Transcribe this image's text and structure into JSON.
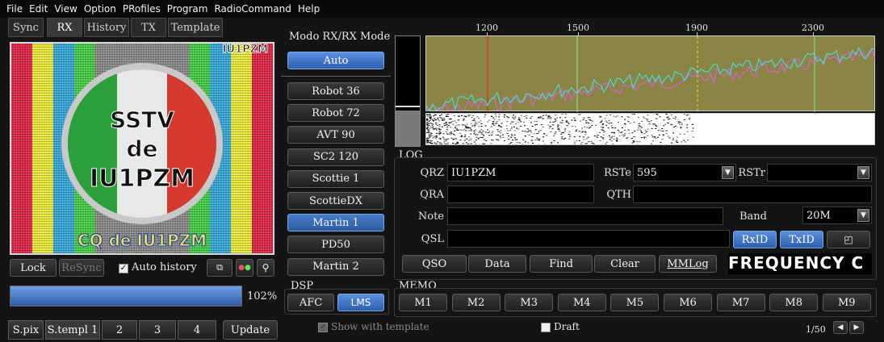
{
  "menu": [
    "File",
    "Edit",
    "View",
    "Option",
    "PRofiles",
    "Program",
    "RadioCommand",
    "Help"
  ],
  "tabs": [
    "Sync",
    "RX",
    "History",
    "TX",
    "Template"
  ],
  "image": {
    "callsign_corner": "IU1PZM",
    "line1": "SSTV",
    "line2": "de",
    "line3": "IU1PZM",
    "bottom": "CQ de IU1PZM"
  },
  "controls": {
    "lock": "Lock",
    "resync": "ReSync",
    "auto_history": "Auto history",
    "progress_pct": "102%",
    "progress_value": 1.0
  },
  "mode": {
    "title": "Modo RX/RX Mode",
    "auto": "Auto",
    "items": [
      "Robot 36",
      "Robot 72",
      "AVT 90",
      "SC2 120",
      "Scottie 1",
      "ScottieDX",
      "Martin 1",
      "PD50",
      "Martin 2"
    ],
    "selected": "Martin 1"
  },
  "spectrum": {
    "ticks": [
      "1200",
      "1500",
      "1900",
      "2300"
    ]
  },
  "log": {
    "title": "LOG",
    "qrz_label": "QRZ",
    "qrz": "IU1PZM",
    "rste_label": "RSTe",
    "rste": "595",
    "rstr_label": "RSTr",
    "rstr": "",
    "qra_label": "QRA",
    "qra": "",
    "qth_label": "QTH",
    "qth": "",
    "note_label": "Note",
    "note": "",
    "band_label": "Band",
    "band": "20M",
    "qsl_label": "QSL",
    "qsl": "",
    "rxid": "RxID",
    "txid": "TxID",
    "buttons": [
      "QSO",
      "Data",
      "Find",
      "Clear",
      "MMLog"
    ],
    "frequency_display": "FREQUENCY C"
  },
  "dsp": {
    "title": "DSP",
    "afc": "AFC",
    "lms": "LMS"
  },
  "memo": {
    "title": "MEMO",
    "items": [
      "M1",
      "M2",
      "M3",
      "M4",
      "M5",
      "M6",
      "M7",
      "M8",
      "M9"
    ]
  },
  "bottom": {
    "tabs": [
      "S.pix",
      "S.templ 1",
      "2",
      "3",
      "4"
    ],
    "update": "Update",
    "show_with_template": "Show with template",
    "draft": "Draft",
    "page": "1/50"
  },
  "colors": {
    "accent_blue": "#3a6fc0",
    "spectrum_bg": "#8a8545",
    "trace_cyan": "#40e8e8",
    "trace_magenta": "#e060e0"
  }
}
